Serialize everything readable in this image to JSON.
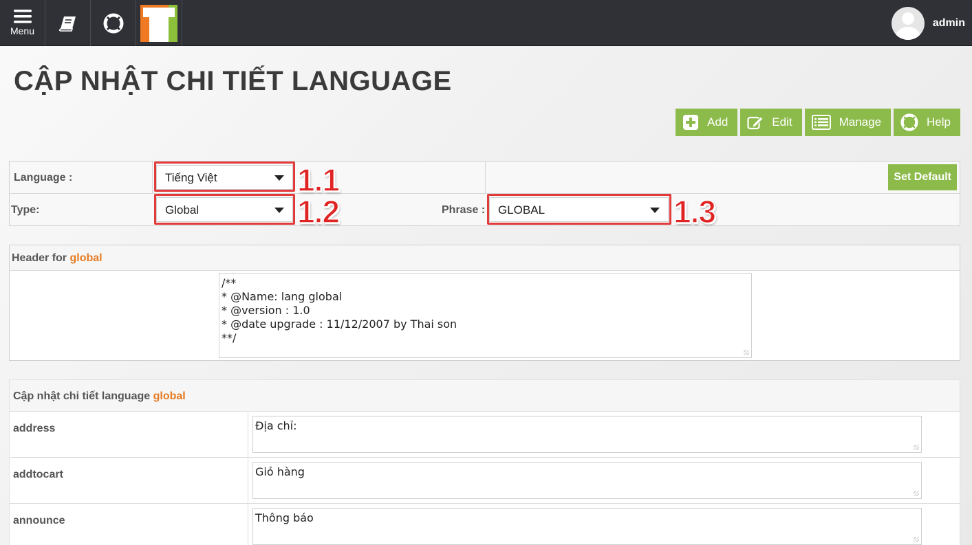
{
  "topbar": {
    "menu_label": "Menu",
    "user_name": "admin"
  },
  "page": {
    "title": "CẬP NHẬT CHI TIẾT LANGUAGE"
  },
  "actions": {
    "add": "Add",
    "edit": "Edit",
    "manage": "Manage",
    "help": "Help"
  },
  "filter": {
    "language_label": "Language :",
    "language_value": "Tiếng Việt",
    "type_label": "Type:",
    "type_value": "Global",
    "phrase_label": "Phrase :",
    "phrase_value": "GLOBAL",
    "set_default": "Set Default"
  },
  "annotations": {
    "a1": "1.1",
    "a2": "1.2",
    "a3": "1.3"
  },
  "header_section": {
    "caption": "Header for",
    "caption_highlight": "global",
    "content": "/**\n* @Name: lang global\n* @version : 1.0\n* @date upgrade : 11/12/2007 by Thai son\n**/"
  },
  "details": {
    "caption": "Cập nhật chi tiết language",
    "caption_highlight": "global",
    "rows": [
      {
        "key": "address",
        "value": "Địa chỉ:"
      },
      {
        "key": "addtocart",
        "value": "Giỏ hàng"
      },
      {
        "key": "announce",
        "value": "Thông báo"
      }
    ]
  },
  "colors": {
    "topbar": "#2f3136",
    "accent_green": "#8dbb4b",
    "highlight_orange": "#e77b23",
    "annotation_red": "#e02424"
  }
}
